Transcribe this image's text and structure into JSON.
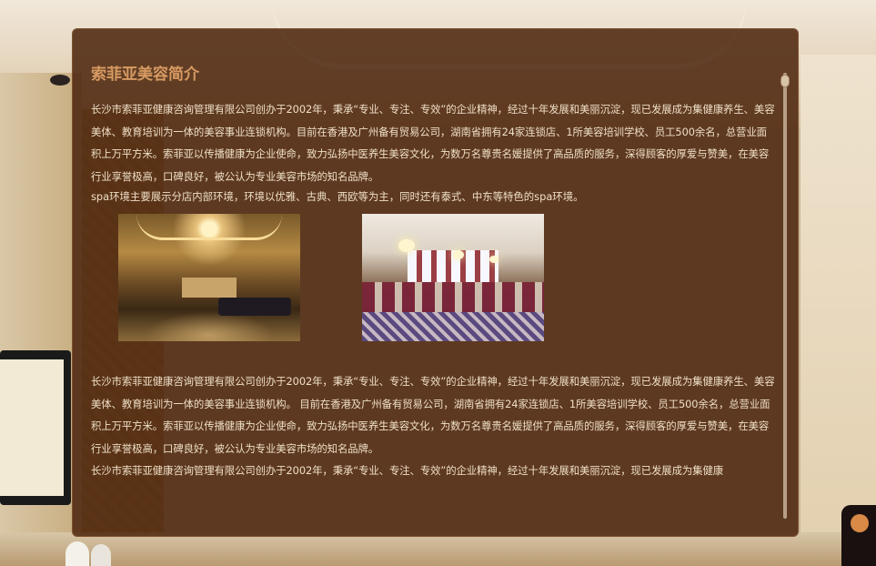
{
  "page": {
    "title": "索菲亚美容简介",
    "paragraph_1": "长沙市索菲亚健康咨询管理有限公司创办于2002年，秉承“专业、专注、专效”的企业精神，经过十年发展和美丽沉淀，现已发展成为集健康养生、美容美体、教育培训为一体的美容事业连锁机构。目前在香港及广州备有贸易公司，湖南省拥有24家连锁店、1所美容培训学校、员工500余名，总营业面积上万平方米。索菲亚以传播健康为企业使命，致力弘扬中医养生美容文化，为数万名尊贵名媛提供了高品质的服务，深得顾客的厚爱与赞美，在美容行业享誉极高，口碑良好，被公认为专业美容市场的知名品牌。",
    "spa_note": "spa环境主要展示分店内部环境，环境以优雅、古典、西欧等为主，同时还有泰式、中东等特色的spa环境。",
    "paragraph_2": "长沙市索菲亚健康咨询管理有限公司创办于2002年，秉承“专业、专注、专效”的企业精神，经过十年发展和美丽沉淀，现已发展成为集健康养生、美容美体、教育培训为一体的美容事业连锁机构。 目前在香港及广州备有贸易公司，湖南省拥有24家连锁店、1所美容培训学校、员工500余名，总营业面积上万平方米。索菲亚以传播健康为企业使命，致力弘扬中医养生美容文化，为数万名尊贵名媛提供了高品质的服务，深得顾客的厚爱与赞美，在美容行业享誉极高，口碑良好，被公认为专业美容市场的知名品牌。",
    "paragraph_3": "长沙市索菲亚健康咨询管理有限公司创办于2002年，秉承“专业、专注、专效”的企业精神，经过十年发展和美丽沉淀，现已发展成为集健康"
  },
  "colors": {
    "title": "#d79a62",
    "text": "#eedfc6",
    "panel": "#4e2810"
  },
  "icons": {
    "scroll_thumb": "scroll-thumb"
  }
}
